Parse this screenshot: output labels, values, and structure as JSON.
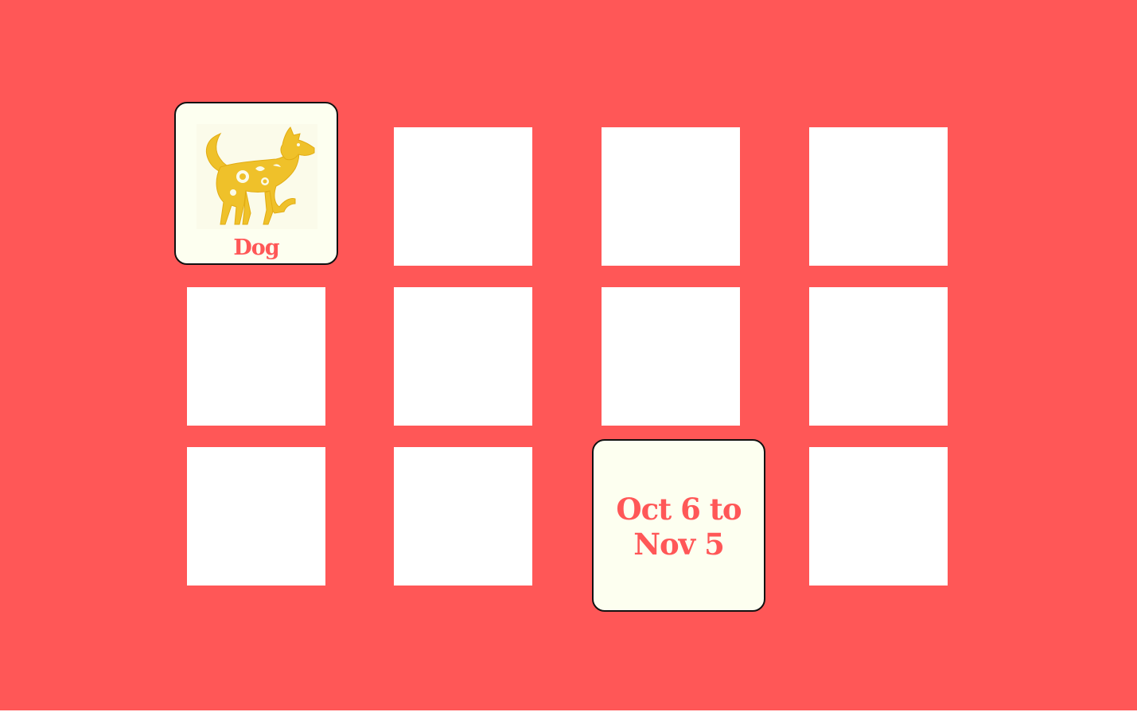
{
  "game": {
    "type": "memory-match",
    "background_color": "#ff5757",
    "card_back_color": "#ffffff",
    "card_face_color": "#fdfff0",
    "text_color": "#ff5757",
    "grid": {
      "rows": 3,
      "columns": 4
    },
    "cards": [
      {
        "row": 1,
        "col": 1,
        "state": "revealed",
        "kind": "picture",
        "icon": "dog-icon",
        "label": "Dog"
      },
      {
        "row": 1,
        "col": 2,
        "state": "hidden"
      },
      {
        "row": 1,
        "col": 3,
        "state": "hidden"
      },
      {
        "row": 1,
        "col": 4,
        "state": "hidden"
      },
      {
        "row": 2,
        "col": 1,
        "state": "hidden"
      },
      {
        "row": 2,
        "col": 2,
        "state": "hidden"
      },
      {
        "row": 2,
        "col": 3,
        "state": "hidden"
      },
      {
        "row": 2,
        "col": 4,
        "state": "hidden"
      },
      {
        "row": 3,
        "col": 1,
        "state": "hidden"
      },
      {
        "row": 3,
        "col": 2,
        "state": "hidden"
      },
      {
        "row": 3,
        "col": 3,
        "state": "revealed",
        "kind": "text",
        "label": "Oct 6 to\nNov 5"
      },
      {
        "row": 3,
        "col": 4,
        "state": "hidden"
      }
    ]
  }
}
